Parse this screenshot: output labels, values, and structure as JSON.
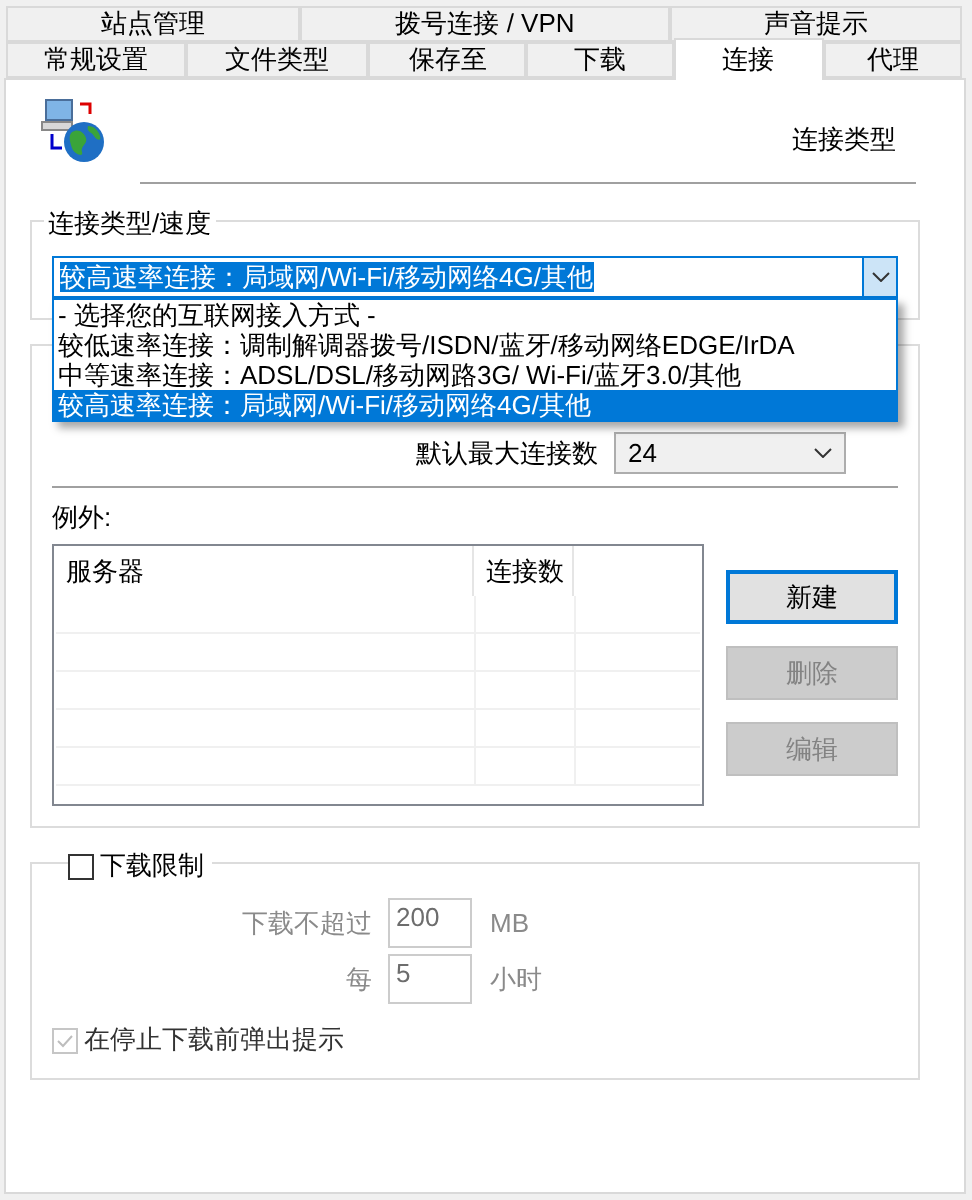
{
  "tabs": [
    [
      {
        "label": "站点管理",
        "selected": false
      },
      {
        "label": "拨号连接 / VPN",
        "selected": false
      },
      {
        "label": "声音提示",
        "selected": false
      }
    ],
    [
      {
        "label": "常规设置",
        "selected": false
      },
      {
        "label": "文件类型",
        "selected": false
      },
      {
        "label": "保存至",
        "selected": false
      },
      {
        "label": "下载",
        "selected": false
      },
      {
        "label": "连接",
        "selected": true
      },
      {
        "label": "代理",
        "selected": false
      }
    ]
  ],
  "header": {
    "title": "连接类型"
  },
  "connection_type": {
    "label": "连接类型/速度",
    "value": "较高速率连接：局域网/Wi-Fi/移动网络4G/其他",
    "expanded": true,
    "options": [
      {
        "label": "- 选择您的互联网接入方式 -",
        "selected": false
      },
      {
        "label": "较低速率连接：调制解调器拨号/ISDN/蓝牙/移动网络EDGE/IrDA",
        "selected": false
      },
      {
        "label": "中等速率连接：ADSL/DSL/移动网路3G/ Wi-Fi/蓝牙3.0/其他",
        "selected": false
      },
      {
        "label": "较高速率连接：局域网/Wi-Fi/移动网络4G/其他",
        "selected": true
      }
    ]
  },
  "max_connections": {
    "label": "默认最大连接数",
    "value": "24"
  },
  "exceptions": {
    "label": "例外:",
    "columns": [
      "服务器",
      "连接数"
    ],
    "buttons": [
      {
        "label": "新建",
        "disabled": false,
        "focused": true
      },
      {
        "label": "删除",
        "disabled": true,
        "focused": false
      },
      {
        "label": "编辑",
        "disabled": true,
        "focused": false
      }
    ]
  },
  "download_limit": {
    "label": "下载限制",
    "checked": false,
    "fields": [
      {
        "label": "下载不超过",
        "value": "200",
        "unit": "MB"
      },
      {
        "label": "每",
        "value": "5",
        "unit": "小时"
      }
    ],
    "prompt": {
      "label": "在停止下载前弹出提示",
      "checked": true,
      "disabled": true
    }
  }
}
